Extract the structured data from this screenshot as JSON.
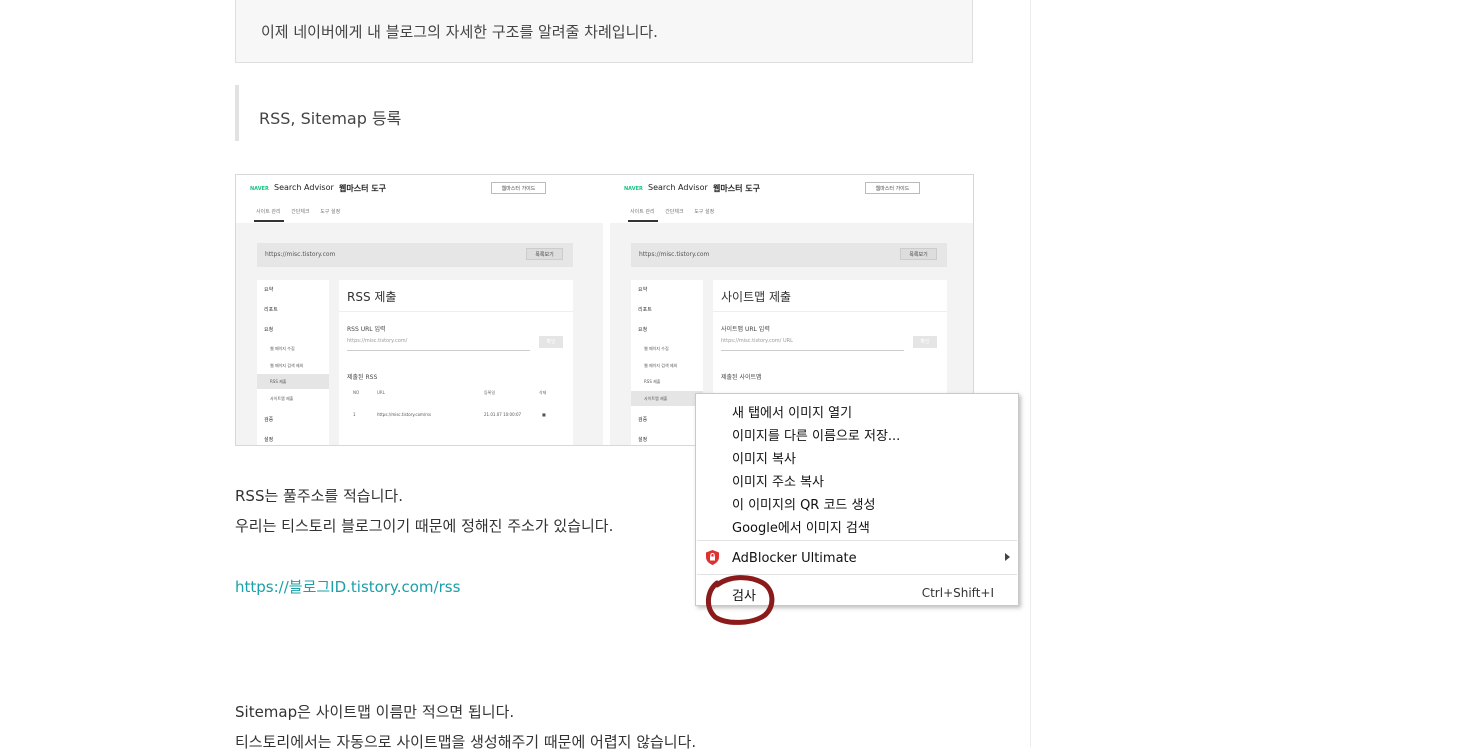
{
  "article": {
    "note": "이제 네이버에게 내 블로그의 자세한 구조를 알려줄 차례입니다.",
    "quote": "RSS, Sitemap 등록",
    "p1": "RSS는 풀주소를 적습니다.",
    "p2": "우리는 티스토리 블로그이기 때문에 정해진 주소가 있습니다.",
    "link": "https://블로그ID.tistory.com/rss",
    "p3": "Sitemap은 사이트맵 이름만 적으면 됩니다.",
    "p4": "티스토리에서는 자동으로 사이트맵을 생성해주기 때문에 어렵지 않습니다."
  },
  "screenshot": {
    "logo": "NAVER",
    "app": "Search Advisor",
    "tool": "웹마스터 도구",
    "guide": "웹마스터 가이드",
    "tabs": [
      "사이트 관리",
      "간단체크",
      "도구 설정"
    ],
    "url": "https://misc.tistory.com",
    "list_btn": "목록보기",
    "nav": [
      "요약",
      "리포트",
      "요청",
      "웹 페이지 수집",
      "웹 페이지 검색 제외",
      "RSS 제출",
      "사이트맵 제출",
      "검증",
      "설정"
    ],
    "left": {
      "title": "RSS 제출",
      "input_label": "RSS URL 입력",
      "placeholder": "https://misc.tistory.com/",
      "ok": "확인",
      "list_title": "제출된 RSS",
      "cols": [
        "NO",
        "URL",
        "등록일",
        "삭제"
      ],
      "row": [
        "1",
        "https://misc.tistory.com/rss",
        "21.01.07 10:00:07"
      ]
    },
    "right": {
      "title": "사이트맵 제출",
      "input_label": "사이트맵 URL 입력",
      "placeholder": "https://misc.tistory.com/  URL",
      "ok": "확인",
      "list_title": "제출된 사이트맵"
    }
  },
  "context_menu": {
    "items": [
      "새 탭에서 이미지 열기",
      "이미지를 다른 이름으로 저장...",
      "이미지 복사",
      "이미지 주소 복사",
      "이 이미지의 QR 코드 생성",
      "Google에서 이미지 검색"
    ],
    "extension": "AdBlocker Ultimate",
    "inspect": "검사",
    "inspect_shortcut": "Ctrl+Shift+I"
  },
  "colors": {
    "link": "#1aa0a8",
    "annotation": "#8b1a1a",
    "adblock": "#e03030"
  }
}
